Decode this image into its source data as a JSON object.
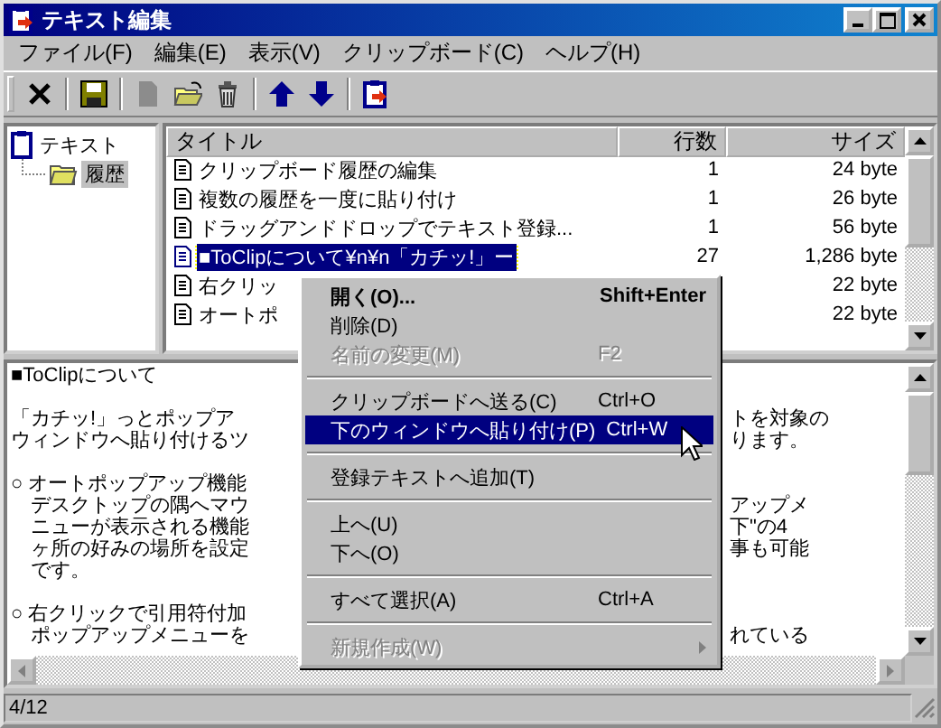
{
  "window": {
    "title": "テキスト編集"
  },
  "menu_bar": [
    "ファイル(F)",
    "編集(E)",
    "表示(V)",
    "クリップボード(C)",
    "ヘルプ(H)"
  ],
  "toolbar": [
    {
      "kind": "close",
      "disabled": false
    },
    {
      "kind": "save",
      "disabled": false
    },
    {
      "kind": "new",
      "disabled": true
    },
    {
      "kind": "open",
      "disabled": false
    },
    {
      "kind": "trash",
      "disabled": false
    },
    {
      "kind": "up",
      "disabled": false
    },
    {
      "kind": "down",
      "disabled": false
    },
    {
      "kind": "clip",
      "disabled": false
    }
  ],
  "tree": [
    {
      "label": "テキスト",
      "selected": false,
      "children": [
        {
          "label": "履歴",
          "selected": true
        }
      ]
    }
  ],
  "table": {
    "columns": [
      "タイトル",
      "行数",
      "サイズ"
    ],
    "rows": [
      {
        "title": "クリップボード履歴の編集",
        "lines": "1",
        "size": "24 byte",
        "selected": false
      },
      {
        "title": "複数の履歴を一度に貼り付け",
        "lines": "1",
        "size": "26 byte",
        "selected": false
      },
      {
        "title": "ドラッグアンドドロップでテキスト登録...",
        "lines": "1",
        "size": "56 byte",
        "selected": false
      },
      {
        "title": "■ToClipについて¥n¥n「カチッ!」ー",
        "lines": "27",
        "size": "1,286 byte",
        "selected": true
      },
      {
        "title": "右クリッ",
        "size": "22 byte",
        "selected": false
      },
      {
        "title": "オートポ",
        "size": "22 byte",
        "selected": false
      }
    ]
  },
  "editor": {
    "lines": [
      {
        "kind": "text",
        "left": "■ToClipについて"
      },
      {
        "kind": "blank"
      },
      {
        "kind": "text",
        "left": "「カチッ!」っとポップア",
        "right": "トを対象の"
      },
      {
        "kind": "text",
        "left": "ウィンドウへ貼り付けるツ",
        "right": "ります。"
      },
      {
        "kind": "blank"
      },
      {
        "kind": "text",
        "left": "○ オートポップアップ機能"
      },
      {
        "kind": "text",
        "left": "　デスクトップの隅へマウ",
        "right": "アップメ"
      },
      {
        "kind": "text",
        "left": "　ニューが表示される機能",
        "right": "下\"の4"
      },
      {
        "kind": "text",
        "left": "　ヶ所の好みの場所を設定",
        "right": "事も可能"
      },
      {
        "kind": "text",
        "left": "　です。"
      },
      {
        "kind": "blank"
      },
      {
        "kind": "text",
        "left": "○ 右クリックで引用符付加"
      },
      {
        "kind": "text",
        "left": "　ポップアップメニューを",
        "right": "れている"
      }
    ]
  },
  "context_menu": [
    {
      "kind": "item",
      "label": "開く(O)...",
      "shortcut": "Shift+Enter",
      "bold": true,
      "disabled": false,
      "selected": false
    },
    {
      "kind": "item",
      "label": "削除(D)",
      "bold": false,
      "disabled": false,
      "selected": false
    },
    {
      "kind": "item",
      "label": "名前の変更(M)",
      "shortcut": "F2",
      "bold": false,
      "disabled": true,
      "selected": false
    },
    {
      "kind": "separator"
    },
    {
      "kind": "item",
      "label": "クリップボードへ送る(C)",
      "shortcut": "Ctrl+O",
      "bold": false,
      "disabled": false,
      "selected": false
    },
    {
      "kind": "item",
      "label": "下のウィンドウへ貼り付け(P)",
      "shortcut": "Ctrl+W",
      "bold": false,
      "disabled": false,
      "selected": true
    },
    {
      "kind": "separator"
    },
    {
      "kind": "item",
      "label": "登録テキストへ追加(T)",
      "bold": false,
      "disabled": false,
      "selected": false
    },
    {
      "kind": "separator"
    },
    {
      "kind": "item",
      "label": "上へ(U)",
      "bold": false,
      "disabled": false,
      "selected": false
    },
    {
      "kind": "item",
      "label": "下へ(O)",
      "bold": false,
      "disabled": false,
      "selected": false
    },
    {
      "kind": "separator"
    },
    {
      "kind": "item",
      "label": "すべて選択(A)",
      "shortcut": "Ctrl+A",
      "bold": false,
      "disabled": false,
      "selected": false
    },
    {
      "kind": "separator"
    },
    {
      "kind": "submenu",
      "label": "新規作成(W)",
      "bold": false,
      "disabled": true,
      "selected": false
    }
  ],
  "status_bar": "4/12"
}
